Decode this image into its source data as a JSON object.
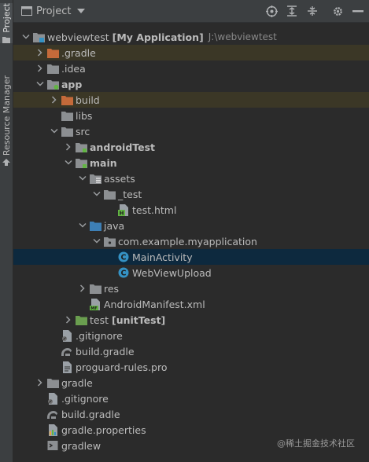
{
  "side_strip": {
    "tabs": [
      {
        "label": "Project",
        "active": true
      },
      {
        "label": "Resource Manager",
        "active": false
      }
    ]
  },
  "header": {
    "title": "Project",
    "tools": [
      "locate-icon",
      "expand-all-icon",
      "collapse-all-icon",
      "gear-icon",
      "hide-icon"
    ]
  },
  "tree": [
    {
      "text": "webviewtest",
      "bold": "[My Application]",
      "path": "J:\\webviewtest",
      "icon": "module-folder-icon"
    },
    {
      "text": ".gradle",
      "icon": "excluded-folder-icon"
    },
    {
      "text": ".idea",
      "icon": "folder-icon"
    },
    {
      "text": "app",
      "icon": "android-module-icon"
    },
    {
      "text": "build",
      "icon": "excluded-folder-icon"
    },
    {
      "text": "libs",
      "icon": "folder-icon"
    },
    {
      "text": "src",
      "icon": "folder-icon"
    },
    {
      "text": "androidTest",
      "icon": "source-set-folder-icon"
    },
    {
      "text": "main",
      "icon": "source-set-folder-icon"
    },
    {
      "text": "assets",
      "icon": "resource-folder-icon"
    },
    {
      "text": "_test",
      "icon": "folder-icon"
    },
    {
      "text": "test.html",
      "icon": "html-file-icon"
    },
    {
      "text": "java",
      "icon": "source-root-folder-icon"
    },
    {
      "text": "com.example.myapplication",
      "icon": "package-icon"
    },
    {
      "text": "MainActivity",
      "icon": "class-icon"
    },
    {
      "text": "WebViewUpload",
      "icon": "class-icon"
    },
    {
      "text": "res",
      "icon": "folder-icon"
    },
    {
      "text": "AndroidManifest.xml",
      "icon": "manifest-file-icon"
    },
    {
      "text": "test",
      "bold": "[unitTest]",
      "icon": "test-folder-icon"
    },
    {
      "text": ".gitignore",
      "icon": "gitignore-file-icon"
    },
    {
      "text": "build.gradle",
      "icon": "gradle-file-icon"
    },
    {
      "text": "proguard-rules.pro",
      "icon": "text-file-icon"
    },
    {
      "text": "gradle",
      "icon": "folder-icon"
    },
    {
      "text": ".gitignore",
      "icon": "gitignore-file-icon"
    },
    {
      "text": "build.gradle",
      "icon": "gradle-file-icon"
    },
    {
      "text": "gradle.properties",
      "icon": "properties-file-icon"
    },
    {
      "text": "gradlew",
      "icon": "script-file-icon"
    }
  ],
  "watermark": "@稀土掘金技术社区",
  "colors": {
    "background": "#2b2b2b",
    "toolbar": "#3c3f41",
    "selection": "#0d293e",
    "excluded_row": "#3b3726",
    "text": "#bbbbbb"
  }
}
